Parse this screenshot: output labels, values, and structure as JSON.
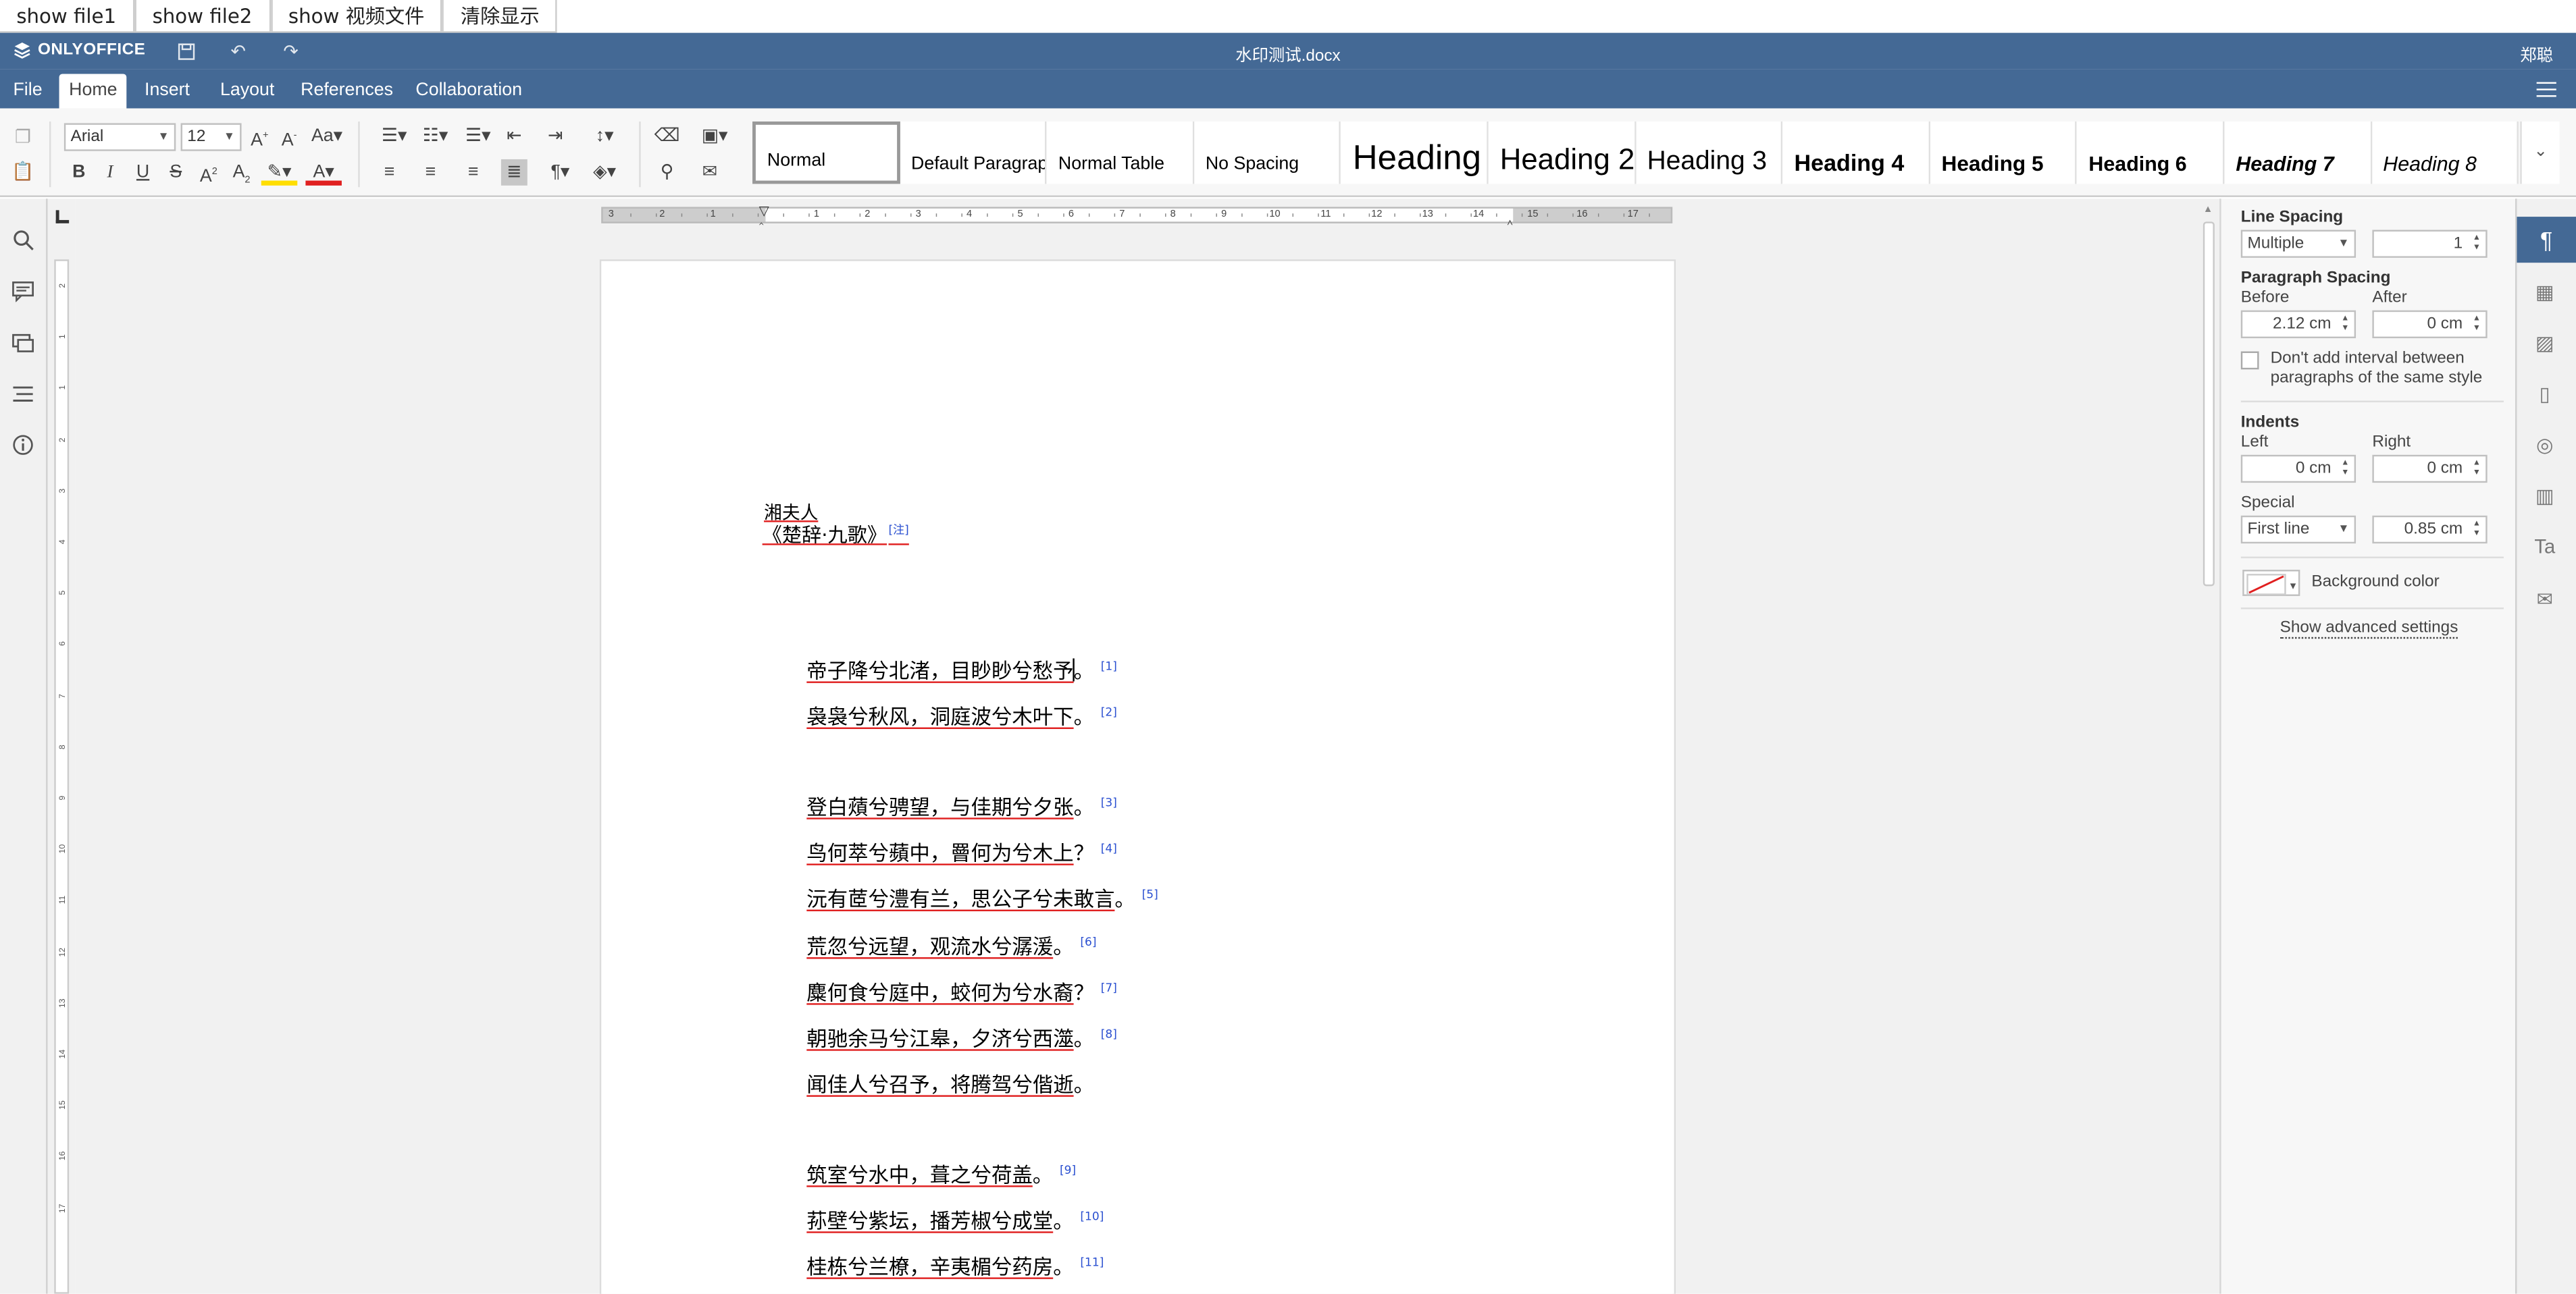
{
  "demo_buttons": [
    "show file1",
    "show file2",
    "show 视频文件",
    "清除显示"
  ],
  "app": {
    "brand": "ONLYOFFICE",
    "doc_title": "水印测试.docx",
    "user": "郑聪",
    "accent": "#446995"
  },
  "tabs": [
    "File",
    "Home",
    "Insert",
    "Layout",
    "References",
    "Collaboration"
  ],
  "toolbar": {
    "font_name": "Arial",
    "font_size": "12"
  },
  "styles": [
    "Normal",
    "Default Paragraph",
    "Normal Table",
    "No Spacing",
    "Heading",
    "Heading 2",
    "Heading 3",
    "Heading 4",
    "Heading 5",
    "Heading 6",
    "Heading 7",
    "Heading 8"
  ],
  "ruler": {
    "h_numbers": [
      "3",
      "2",
      "1",
      "1",
      "2",
      "3",
      "4",
      "5",
      "6",
      "7",
      "8",
      "9",
      "10",
      "11",
      "12",
      "13",
      "14",
      "15",
      "16",
      "17"
    ],
    "v_numbers": [
      "2",
      "1",
      "1",
      "2",
      "3",
      "4",
      "5",
      "6",
      "7",
      "8",
      "9",
      "10",
      "11",
      "12",
      "13",
      "14",
      "15",
      "16",
      "17"
    ]
  },
  "document": {
    "author": "湘夫人",
    "source": "《楚辞·九歌》",
    "source_note": "[注]",
    "lines": [
      {
        "text": "帝子降兮北渚，目眇眇兮愁予",
        "punct": "。",
        "note": "[1]"
      },
      {
        "text": "袅袅兮秋风，洞庭波兮木叶下",
        "punct": "。",
        "note": "[2]"
      },
      {
        "text": "登白薠兮骋望，与佳期兮夕张",
        "punct": "。",
        "note": "[3]"
      },
      {
        "text": "鸟何萃兮蘋中，罾何为兮木上",
        "punct": "？",
        "note": "[4]"
      },
      {
        "text": "沅有茝兮澧有兰，思公子兮未敢言",
        "punct": "。",
        "note": "[5]"
      },
      {
        "text": "荒忽兮远望，观流水兮潺湲",
        "punct": "。",
        "note": "[6]"
      },
      {
        "text": "麋何食兮庭中，蛟何为兮水裔",
        "punct": "？",
        "note": "[7]"
      },
      {
        "text": "朝驰余马兮江皋，夕济兮西澨",
        "punct": "。",
        "note": "[8]"
      },
      {
        "text": "闻佳人兮召予，将腾驾兮偕逝",
        "punct": "。",
        "note": ""
      },
      {
        "text": "筑室兮水中，葺之兮荷盖",
        "punct": "。",
        "note": "[9]"
      },
      {
        "text": "荪壁兮紫坛，播芳椒兮成堂",
        "punct": "。",
        "note": "[10]"
      },
      {
        "text": "桂栋兮兰橑，辛夷楣兮药房",
        "punct": "。",
        "note": "[11]"
      }
    ]
  },
  "paragraph_panel": {
    "line_spacing_title": "Line Spacing",
    "line_spacing_mode": "Multiple",
    "line_spacing_value": "1",
    "paragraph_spacing_title": "Paragraph Spacing",
    "before_label": "Before",
    "before_value": "2.12 cm",
    "after_label": "After",
    "after_value": "0 cm",
    "no_interval_label": "Don't add interval between paragraphs of the same style",
    "indents_title": "Indents",
    "left_label": "Left",
    "left_value": "0 cm",
    "right_label": "Right",
    "right_value": "0 cm",
    "special_label": "Special",
    "special_mode": "First line",
    "special_value": "0.85 cm",
    "background_color_label": "Background color",
    "advanced_link": "Show advanced settings"
  }
}
